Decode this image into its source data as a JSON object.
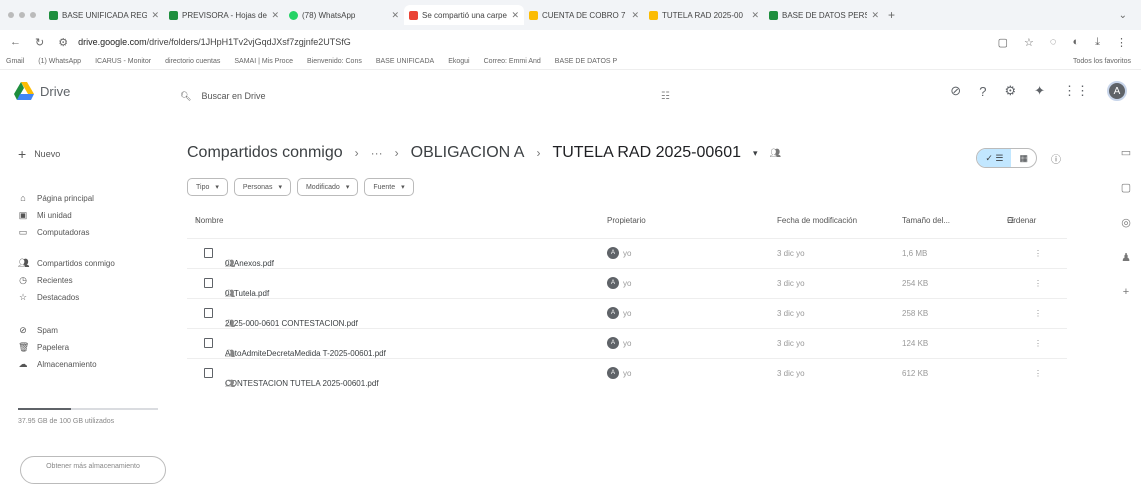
{
  "tabs": [
    {
      "label": "BASE UNIFICADA REGI",
      "active": false
    },
    {
      "label": "PREVISORA - Hojas de",
      "active": false
    },
    {
      "label": "(78) WhatsApp",
      "active": false
    },
    {
      "label": "Se compartió una carpe",
      "active": true
    },
    {
      "label": "CUENTA DE COBRO 7",
      "active": false
    },
    {
      "label": "TUTELA RAD 2025-00",
      "active": false
    },
    {
      "label": "BASE DE DATOS PERS",
      "active": false
    }
  ],
  "address": {
    "host": "drive.google.com",
    "path": "/drive/folders/1JHpH1Tv2vjGqdJXsf7zgjnfe2UTSfG"
  },
  "bookmarks": [
    "Gmail",
    "(1) WhatsApp",
    "ICARUS - Monitor",
    "directorio cuentas",
    "SAMAI | Mis Proce",
    "Bienvenido: Cons",
    "BASE UNIFICADA",
    "Ekogui",
    "Correo: Emmi And",
    "BASE DE DATOS P"
  ],
  "bookmarks_all": "Todos los favoritos",
  "drive": {
    "logo_text": "Drive",
    "search_placeholder": "Buscar en Drive",
    "avatar_letter": "A"
  },
  "sidebar": {
    "new_label": "Nuevo",
    "items": [
      {
        "label": "Página principal",
        "icon": "home-icon"
      },
      {
        "label": "Mi unidad",
        "icon": "drive-icon"
      },
      {
        "label": "Computadoras",
        "icon": "computer-icon"
      },
      {
        "label": "Compartidos conmigo",
        "icon": "people-icon"
      },
      {
        "label": "Recientes",
        "icon": "clock-icon"
      },
      {
        "label": "Destacados",
        "icon": "star-icon"
      },
      {
        "label": "Spam",
        "icon": "spam-icon"
      },
      {
        "label": "Papelera",
        "icon": "trash-icon"
      },
      {
        "label": "Almacenamiento",
        "icon": "cloud-icon"
      }
    ],
    "storage_text": "37.95 GB de 100 GB utilizados",
    "storage_fraction": 0.3795,
    "get_more": "Obtener más almacenamiento"
  },
  "breadcrumb": {
    "root": "Compartidos conmigo",
    "ellipsis": "···",
    "mid": "OBLIGACION A",
    "current": "TUTELA RAD 2025-00601"
  },
  "filters": [
    "Tipo",
    "Personas",
    "Modificado",
    "Fuente"
  ],
  "columns": {
    "name": "Nombre",
    "owner": "Propietario",
    "modified": "Fecha de modificación",
    "size": "Tamaño del...",
    "sort": "Ordenar"
  },
  "files": [
    {
      "name": "02Anexos.pdf",
      "owner": "yo",
      "modified": "3 dic yo",
      "size": "1,6 MB"
    },
    {
      "name": "03Tutela.pdf",
      "owner": "yo",
      "modified": "3 dic yo",
      "size": "254 KB"
    },
    {
      "name": "2025-000-0601 CONTESTACION.pdf",
      "owner": "yo",
      "modified": "3 dic yo",
      "size": "258 KB"
    },
    {
      "name": "AutoAdmiteDecretaMedida T-2025-00601.pdf",
      "owner": "yo",
      "modified": "3 dic yo",
      "size": "124 KB"
    },
    {
      "name": "CONTESTACION TUTELA 2025-00601.pdf",
      "owner": "yo",
      "modified": "3 dic yo",
      "size": "612 KB"
    }
  ]
}
